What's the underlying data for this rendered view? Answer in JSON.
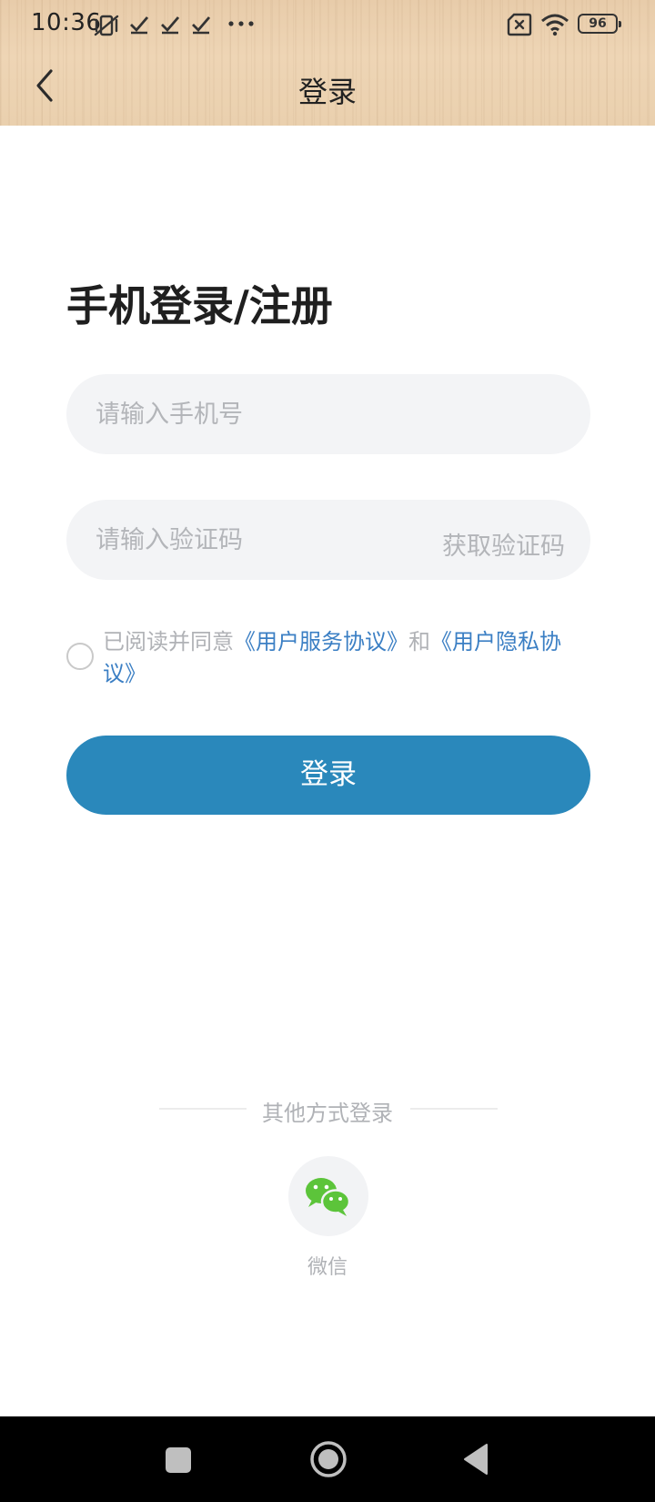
{
  "status_bar": {
    "time": "10:36",
    "left_icons": [
      "vibrate-off-icon",
      "check-icon",
      "check-icon",
      "check-icon",
      "more-dots-icon"
    ],
    "right_icons": [
      "sim-error-icon",
      "wifi-icon"
    ],
    "battery": "96"
  },
  "header": {
    "title": "登录",
    "back_icon": "chevron-left-icon"
  },
  "page_title": "手机登录/注册",
  "phone_input": {
    "value": "",
    "placeholder": "请输入手机号"
  },
  "code_input": {
    "value": "",
    "placeholder": "请输入验证码"
  },
  "get_code_label": "获取验证码",
  "agreement": {
    "prefix": "已阅读并同意",
    "service_link": "《用户服务协议》",
    "conjunction": "和",
    "privacy_link": "《用户隐私协议》",
    "checked": false
  },
  "login_button": "登录",
  "other_login": {
    "label": "其他方式登录",
    "wechat_label": "微信"
  },
  "colors": {
    "accent": "#2a88bb",
    "link": "#3b7fc4",
    "wechat_green": "#5cc43a",
    "placeholder": "#b3b5b9"
  }
}
